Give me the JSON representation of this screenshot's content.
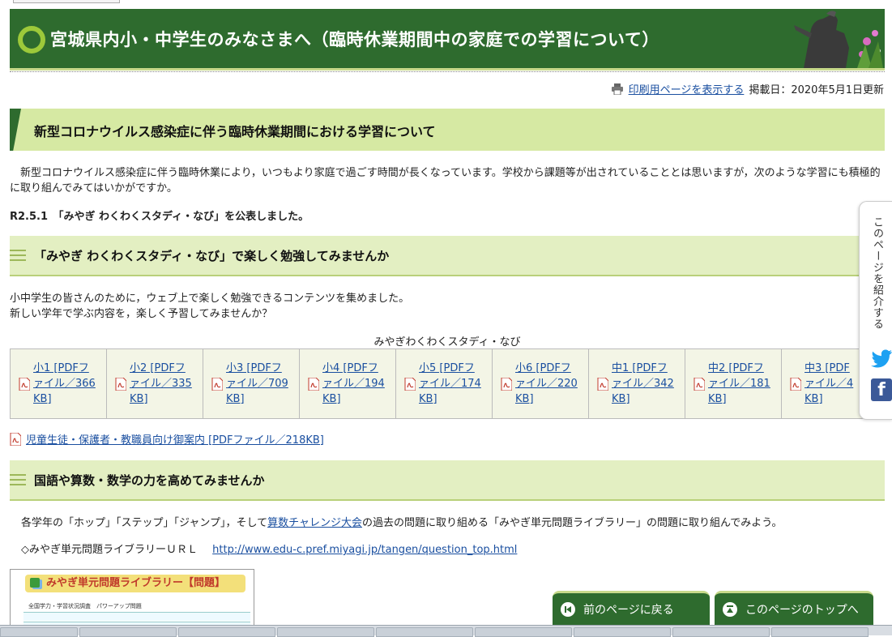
{
  "header": {
    "title": "宮城県内小・中学生のみなさまへ（臨時休業期間中の家庭での学習について）"
  },
  "print_bar": {
    "print_link": "印刷用ページを表示する",
    "date": "掲載日：2020年5月1日更新"
  },
  "section1": {
    "heading": "新型コロナウイルス感染症に伴う臨時休業期間における学習について",
    "intro": "新型コロナウイルス感染症に伴う臨時休業により，いつもより家庭で過ごす時間が長くなっています。学校から課題等が出されていることとは思いますが，次のような学習にも積極的に取り組んでみてはいかがですか。",
    "notice": "R2.5.1　「みやぎ わくわくスタディ・なび」を公表しました。"
  },
  "section2": {
    "heading": "「みやぎ わくわくスタディ・なび」で楽しく勉強してみませんか",
    "line1": "小中学生の皆さんのために，ウェブ上で楽しく勉強できるコンテンツを集めました。",
    "line2": "新しい学年で学ぶ内容を，楽しく予習してみませんか？",
    "table_caption": "みやぎわくわくスタディ・なび",
    "pdf_links": [
      {
        "l1": "小1 [PDFフ",
        "l2": "ァイル／366",
        "l3": "KB]"
      },
      {
        "l1": "小2 [PDFフ",
        "l2": "ァイル／335",
        "l3": "KB]"
      },
      {
        "l1": "小3 [PDFフ",
        "l2": "ァイル／709",
        "l3": "KB]"
      },
      {
        "l1": "小4 [PDFフ",
        "l2": "ァイル／194",
        "l3": "KB]"
      },
      {
        "l1": "小5 [PDFフ",
        "l2": "ァイル／174",
        "l3": "KB]"
      },
      {
        "l1": "小6 [PDFフ",
        "l2": "ァイル／220",
        "l3": "KB]"
      },
      {
        "l1": "中1 [PDFフ",
        "l2": "ァイル／342",
        "l3": "KB]"
      },
      {
        "l1": "中2 [PDFフ",
        "l2": "ァイル／181",
        "l3": "KB]"
      },
      {
        "l1": "中3 [PDF",
        "l2": "ァイル／4",
        "l3": "KB]"
      }
    ],
    "guide_link": "児童生徒・保護者・教職員向け御案内 [PDFファイル／218KB]"
  },
  "section3": {
    "heading": "国語や算数・数学の力を高めてみませんか",
    "text_before": "各学年の「ホップ」「ステップ」「ジャンプ」，そして",
    "link": "算数チャレンジ大会",
    "text_after": "の過去の問題に取り組める「みやぎ単元問題ライブラリー」の問題に取り組んでみよう。",
    "url_label": "◇みやぎ単元問題ライブラリーＵＲＬ",
    "url": "http://www.edu-c.pref.miyagi.jp/tangen/question_top.html",
    "image_title": "みやぎ単元問題ライブラリー【問題】",
    "image_subtitle": "全国学力・学習状況調査　パワーアップ問題"
  },
  "share": {
    "label": "このページを紹介する",
    "facebook_letter": "f"
  },
  "nav": {
    "back": "前のページに戻る",
    "top": "このページのトップへ"
  },
  "colors": {
    "banner": "#2e6b2e",
    "accent_green": "#9dc93a",
    "heading_bg": "#d6e9a3",
    "link": "#1a4fa0"
  }
}
